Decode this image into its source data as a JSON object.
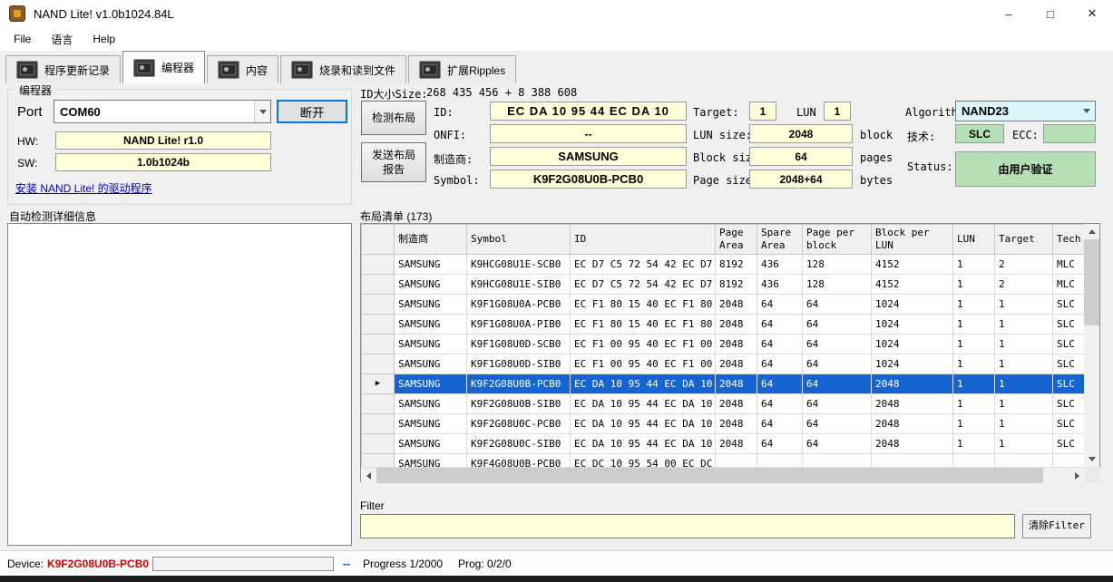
{
  "colors": {
    "field_yellow": "#ffffd9",
    "field_green": "#b5e0b5",
    "algorithm_cyan": "#dcf5fa",
    "selection_blue": "#1464d2",
    "device_red": "#d40000",
    "link_blue": "#0000cc",
    "default_button_border": "#0078d7"
  },
  "window": {
    "title": "NAND Lite! v1.0b1024.84L",
    "controls": {
      "minimize": "–",
      "maximize": "□",
      "close": "✕"
    }
  },
  "menu": {
    "items": [
      {
        "label": "File"
      },
      {
        "label": "语言"
      },
      {
        "label": "Help"
      }
    ]
  },
  "tabs": [
    {
      "label": "程序更新记录",
      "active": false
    },
    {
      "label": "编程器",
      "active": true
    },
    {
      "label": "内容",
      "active": false
    },
    {
      "label": "烧录和读到文件",
      "active": false
    },
    {
      "label": "扩展Ripples",
      "active": false
    }
  ],
  "programmer_group": {
    "title": "编程器",
    "port_label": "Port",
    "port_value": "COM60",
    "disconnect_button": "断开",
    "hw_label": "HW:",
    "hw_value": "NAND Lite! r1.0",
    "sw_label": "SW:",
    "sw_value": "1.0b1024b",
    "driver_link": "安装 NAND Lite! 的驱动程序"
  },
  "autodetect": {
    "label": "自动检测详细信息",
    "content": ""
  },
  "device_info": {
    "id_size_label": "ID大小Size:",
    "id_size_value": "268 435 456 + 8 388 608",
    "detect_layout_button": "检测布局",
    "send_report_button_line1": "发送布局",
    "send_report_button_line2": "报告",
    "id_label": "ID:",
    "id_value": "EC DA 10 95 44 EC DA 10",
    "onfi_label": "ONFI:",
    "onfi_value": "--",
    "manufacturer_label": "制造商:",
    "manufacturer_value": "SAMSUNG",
    "symbol_label": "Symbol:",
    "symbol_value": "K9F2G08U0B-PCB0",
    "target_label": "Target:",
    "target_value": "1",
    "lun_label": "LUN",
    "lun_value": "1",
    "lun_size_label": "LUN size:",
    "lun_size_value": "2048",
    "lun_size_unit": "block",
    "block_size_label": "Block size::",
    "block_size_value": "64",
    "block_size_unit": "pages",
    "page_size_label": "Page size:",
    "page_size_value": "2048+64",
    "page_size_unit": "bytes",
    "algorithm_label": "Algorithm",
    "algorithm_value": "NAND23",
    "tech_label": "技术:",
    "tech_value": "SLC",
    "ecc_label": "ECC:",
    "ecc_value": "",
    "status_label": "Status:",
    "status_value": "由用户验证"
  },
  "layout_list": {
    "title": "布局清单 (173)",
    "selection_marker": "▶",
    "columns": [
      "制造商",
      "Symbol",
      "ID",
      "Page Area",
      "Spare Area",
      "Page per block",
      "Block per LUN",
      "LUN",
      "Target",
      "Tech"
    ],
    "rows": [
      {
        "selected": false,
        "cells": [
          "SAMSUNG",
          "K9HCG08U1E-SCB0",
          "EC D7 C5 72 54 42 EC D7",
          "8192",
          "436",
          "128",
          "4152",
          "1",
          "2",
          "MLC"
        ]
      },
      {
        "selected": false,
        "cells": [
          "SAMSUNG",
          "K9HCG08U1E-SIB0",
          "EC D7 C5 72 54 42 EC D7",
          "8192",
          "436",
          "128",
          "4152",
          "1",
          "2",
          "MLC"
        ]
      },
      {
        "selected": false,
        "cells": [
          "SAMSUNG",
          "K9F1G08U0A-PCB0",
          "EC F1 80 15 40 EC F1 80",
          "2048",
          "64",
          "64",
          "1024",
          "1",
          "1",
          "SLC"
        ]
      },
      {
        "selected": false,
        "cells": [
          "SAMSUNG",
          "K9F1G08U0A-PIB0",
          "EC F1 80 15 40 EC F1 80",
          "2048",
          "64",
          "64",
          "1024",
          "1",
          "1",
          "SLC"
        ]
      },
      {
        "selected": false,
        "cells": [
          "SAMSUNG",
          "K9F1G08U0D-SCB0",
          "EC F1 00 95 40 EC F1 00",
          "2048",
          "64",
          "64",
          "1024",
          "1",
          "1",
          "SLC"
        ]
      },
      {
        "selected": false,
        "cells": [
          "SAMSUNG",
          "K9F1G08U0D-SIB0",
          "EC F1 00 95 40 EC F1 00",
          "2048",
          "64",
          "64",
          "1024",
          "1",
          "1",
          "SLC"
        ]
      },
      {
        "selected": true,
        "cells": [
          "SAMSUNG",
          "K9F2G08U0B-PCB0",
          "EC DA 10 95 44 EC DA 10",
          "2048",
          "64",
          "64",
          "2048",
          "1",
          "1",
          "SLC"
        ]
      },
      {
        "selected": false,
        "cells": [
          "SAMSUNG",
          "K9F2G08U0B-SIB0",
          "EC DA 10 95 44 EC DA 10",
          "2048",
          "64",
          "64",
          "2048",
          "1",
          "1",
          "SLC"
        ]
      },
      {
        "selected": false,
        "cells": [
          "SAMSUNG",
          "K9F2G08U0C-PCB0",
          "EC DA 10 95 44 EC DA 10",
          "2048",
          "64",
          "64",
          "2048",
          "1",
          "1",
          "SLC"
        ]
      },
      {
        "selected": false,
        "cells": [
          "SAMSUNG",
          "K9F2G08U0C-SIB0",
          "EC DA 10 95 44 EC DA 10",
          "2048",
          "64",
          "64",
          "2048",
          "1",
          "1",
          "SLC"
        ]
      },
      {
        "selected": false,
        "cells": [
          "SAMSUNG",
          "K9F4G08U0B-PCB0",
          "EC DC 10 95 54 00 EC DC",
          "",
          "",
          "",
          "",
          "",
          "",
          ""
        ]
      }
    ]
  },
  "filter": {
    "label": "Filter",
    "value": "",
    "clear_button": "清除Filter"
  },
  "status_bar": {
    "device_label": "Device:",
    "device_value": "K9F2G08U0B-PCB0",
    "separator": "--",
    "progress_text": "Progress 1/2000",
    "prog_text": "Prog: 0/2/0"
  }
}
